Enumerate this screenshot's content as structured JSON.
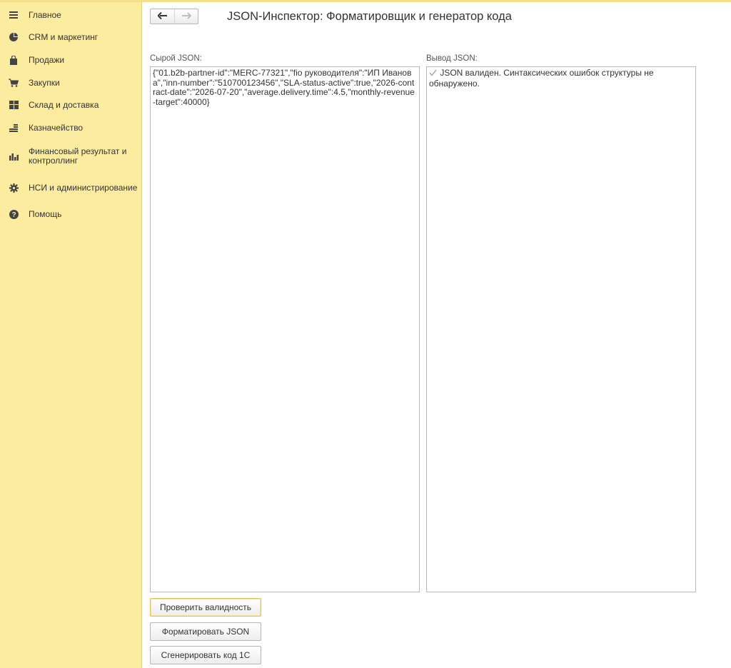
{
  "sidebar": {
    "items": [
      {
        "label": "Главное",
        "icon": "hamburger-icon"
      },
      {
        "label": "CRM и маркетинг",
        "icon": "pie-chart-icon"
      },
      {
        "label": "Продажи",
        "icon": "shopping-bag-icon"
      },
      {
        "label": "Закупки",
        "icon": "shopping-cart-icon"
      },
      {
        "label": "Склад и доставка",
        "icon": "warehouse-grid-icon"
      },
      {
        "label": "Казначейство",
        "icon": "coins-icon"
      },
      {
        "label": "Финансовый результат и контроллинг",
        "icon": "bar-chart-icon"
      },
      {
        "label": "НСИ и администрирование",
        "icon": "gear-icon"
      },
      {
        "label": "Помощь",
        "icon": "question-icon"
      }
    ]
  },
  "nav": {
    "back_icon": "arrow-left-icon",
    "forward_icon": "arrow-right-icon"
  },
  "page": {
    "title": "JSON-Инспектор: Форматировщик и генератор кода"
  },
  "input": {
    "label": "Сырой JSON:",
    "value": "{\"01.b2b-partner-id\":\"MERC-77321\",\"fio руководителя\":\"ИП Иванова\",\"inn-number\":\"510700123456\",\"SLA-status-active\":true,\"2026-contract-date\":\"2026-07-20\",\"average.delivery.time\":4.5,\"monthly-revenue-target\":40000}"
  },
  "output": {
    "label": "Вывод JSON:",
    "icon": "checkmark-icon",
    "value": "JSON валиден. Синтаксических ошибок структуры не обнаружено."
  },
  "buttons": {
    "validate": "Проверить валидность",
    "format": "Форматировать JSON",
    "generate": "Сгенерировать код 1С"
  },
  "colors": {
    "sidebar_bg": "#fbeca0",
    "accent_border": "#e2c25c",
    "text": "#333333"
  }
}
